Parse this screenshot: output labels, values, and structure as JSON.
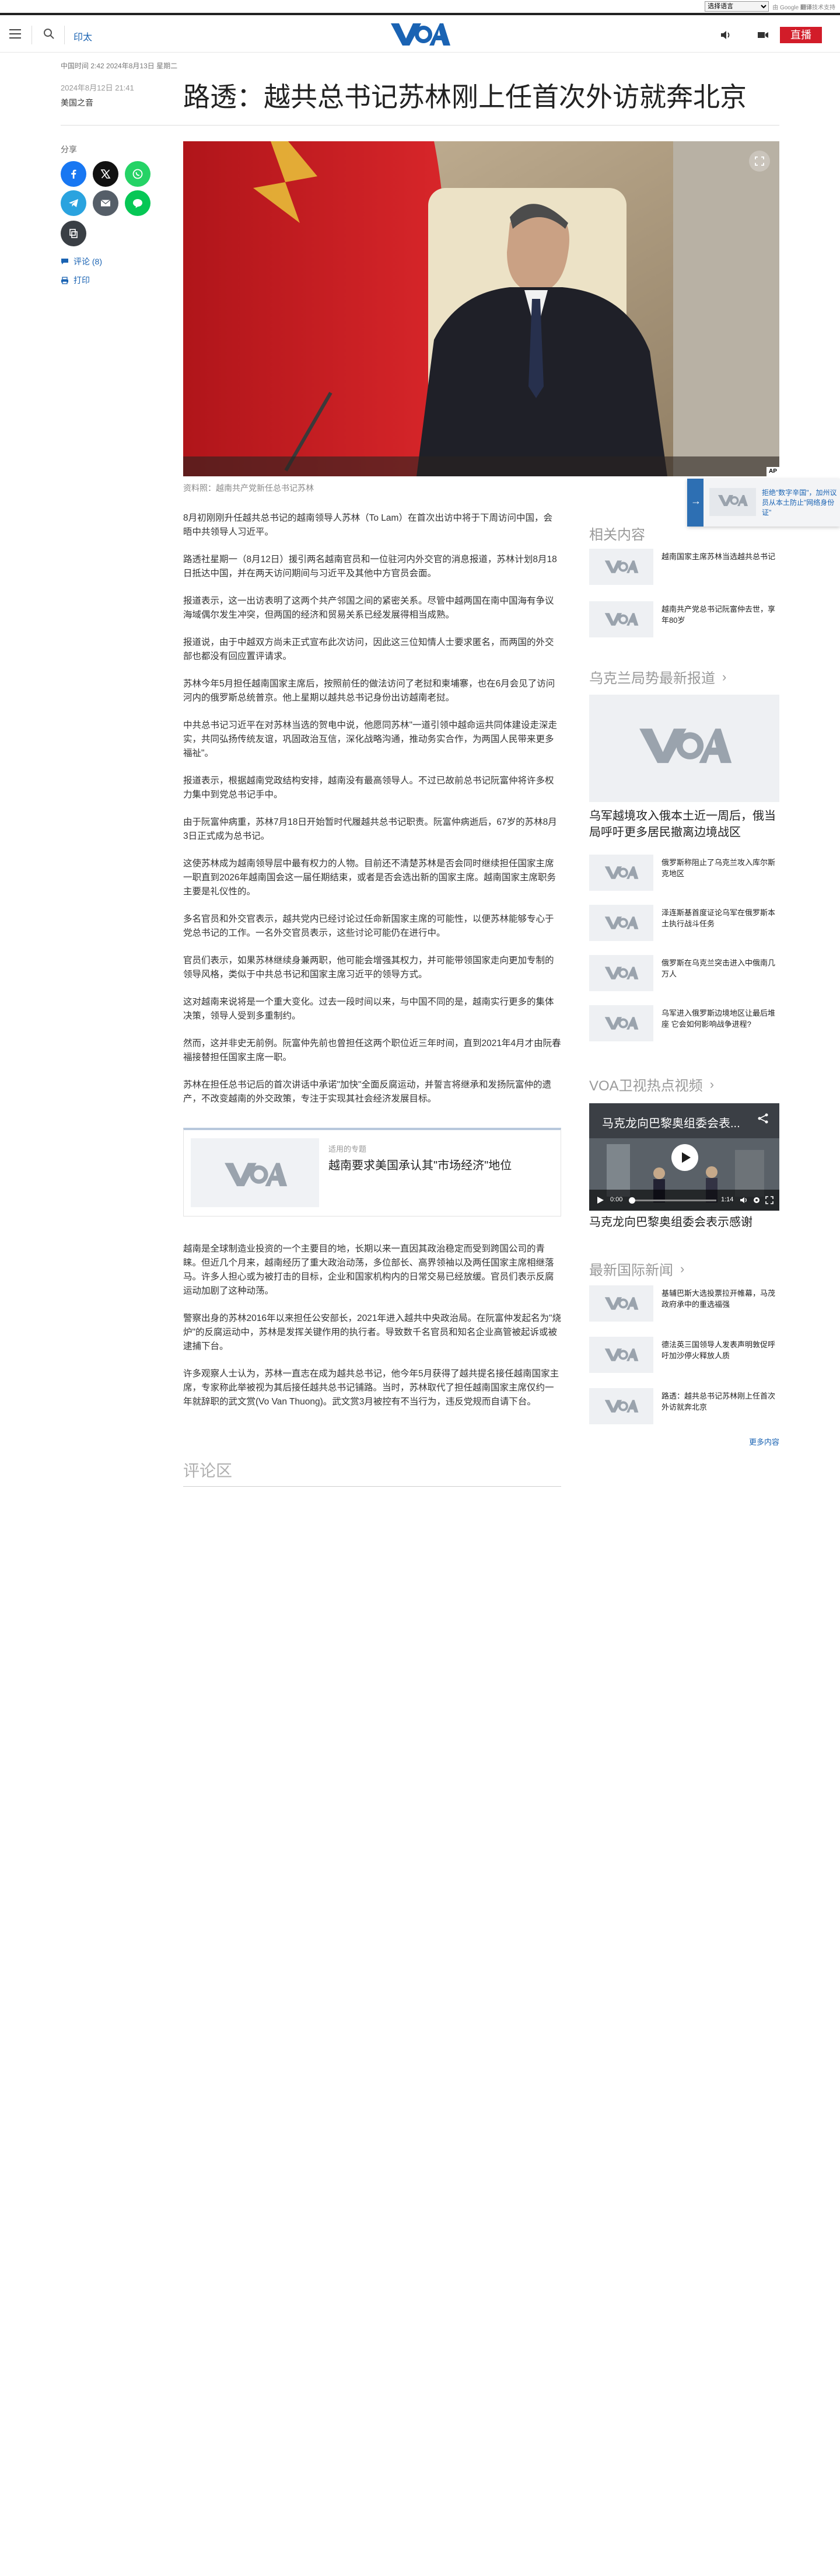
{
  "translate": {
    "select_label": "选择语言",
    "powered_by": "由",
    "powered_brand": "Google",
    "powered_suffix": "翻译",
    "powered_end": "技术支持"
  },
  "header": {
    "edition": "印太",
    "logo": "VOA",
    "live_label": "直播",
    "live_color": "#d21c29"
  },
  "meta": {
    "time_line": "中国时间 2:42 2024年8月13日 星期二",
    "published": "2024年8月12日 21:41",
    "author": "美国之音"
  },
  "article": {
    "title": "路透：越共总书记苏林刚上任首次外访就奔北京",
    "caption": "资料照：越南共产党新任总书记苏林",
    "paragraphs": [
      "8月初刚刚升任越共总书记的越南领导人苏林（To Lam）在首次出访中将于下周访问中国，会晤中共领导人习近平。",
      "路透社星期一（8月12日）援引两名越南官员和一位驻河内外交官的消息报道，苏林计划8月18日抵达中国，并在两天访问期间与习近平及其他中方官员会面。",
      "报道表示，这一出访表明了这两个共产邻国之间的紧密关系。尽管中越两国在南中国海有争议海域偶尔发生冲突，但两国的经济和贸易关系已经发展得相当成熟。",
      "报道说，由于中越双方尚未正式宣布此次访问，因此这三位知情人士要求匿名，而两国的外交部也都没有回应置评请求。",
      "苏林今年5月担任越南国家主席后，按照前任的做法访问了老挝和柬埔寨，也在6月会见了访问河内的俄罗斯总统普京。他上星期以越共总书记身份出访越南老挝。",
      "中共总书记习近平在对苏林当选的贺电中说，他愿同苏林\"一道引领中越命运共同体建设走深走实，共同弘扬传统友谊，巩固政治互信，深化战略沟通，推动务实合作，为两国人民带来更多福祉\"。",
      "报道表示，根据越南党政结构安排，越南没有最高领导人。不过已故前总书记阮富仲将许多权力集中到党总书记手中。",
      "由于阮富仲病重，苏林7月18日开始暂时代履越共总书记职责。阮富仲病逝后，67岁的苏林8月3日正式成为总书记。",
      "这使苏林成为越南领导层中最有权力的人物。目前还不清楚苏林是否会同时继续担任国家主席一职直到2026年越南国会这一届任期结束，或者是否会选出新的国家主席。越南国家主席职务主要是礼仪性的。",
      "多名官员和外交官表示，越共党内已经讨论过任命新国家主席的可能性，以便苏林能够专心于党总书记的工作。一名外交官员表示，这些讨论可能仍在进行中。",
      "官员们表示，如果苏林继续身兼两职，他可能会增强其权力，并可能带领国家走向更加专制的领导风格，类似于中共总书记和国家主席习近平的领导方式。",
      "这对越南来说将是一个重大变化。过去一段时间以来，与中国不同的是，越南实行更多的集体决策，领导人受到多重制约。",
      "然而，这并非史无前例。阮富仲先前也曾担任这两个职位近三年时间，直到2021年4月才由阮春福接替担任国家主席一职。",
      "苏林在担任总书记后的首次讲话中承诺\"加快\"全面反腐运动，并誓言将继承和发扬阮富仲的遗产，不改变越南的外交政策，专注于实现其社会经济发展目标。"
    ],
    "related_label": "适用的专题",
    "related_title": "越南要求美国承认其\"市场经济\"地位",
    "paragraphs2": [
      "越南是全球制造业投资的一个主要目的地，长期以来一直因其政治稳定而受到跨国公司的青睐。但近几个月来，越南经历了重大政治动荡，多位部长、高界领袖以及两任国家主席相继落马。许多人担心或为被打击的目标，企业和国家机构内的日常交易已经放缓。官员们表示反腐运动加剧了这种动荡。",
      "警察出身的苏林2016年以来担任公安部长，2021年进入越共中央政治局。在阮富仲发起名为\"烧炉\"的反腐运动中，苏林是发挥关键作用的执行者。导致数千名官员和知名企业高管被起诉或被逮捕下台。",
      "许多观察人士认为，苏林一直志在成为越共总书记，他今年5月获得了越共提名接任越南国家主席，专家称此举被视为其后接任越共总书记铺路。当时，苏林取代了担任越南国家主席仅约一年就辞职的武文赏(Vo Van Thuong)。武文赏3月被控有不当行为，违反党规而自请下台。"
    ],
    "comments_title": "评论区"
  },
  "share": {
    "label": "分享",
    "comments_link": "评论 (8)",
    "print_link": "打印",
    "colors": {
      "facebook": "#1877f2",
      "x": "#111111",
      "whatsapp": "#25d366",
      "telegram": "#2aa3df",
      "email": "#555e68",
      "line": "#06c755",
      "copy": "#3a3f45"
    }
  },
  "sidebar": {
    "related_title": "相关内容",
    "related_items": [
      "越南国家主席苏林当选越共总书记",
      "越南共产党总书记阮富仲去世，享年80岁"
    ],
    "ukraine_title": "乌克兰局势最新报道",
    "ukraine_big_caption": "乌军越境攻入俄本土近一周后，俄当局呼吁更多居民撤离边境战区",
    "ukraine_items": [
      "俄罗斯称阻止了乌克兰攻入库尔斯克地区",
      "泽连斯基首度证论乌军在俄罗斯本土执行战斗任务",
      "俄罗斯在乌克兰突击进入中俄南几万人",
      "乌军进入俄罗斯边境地区让最后堆座 它会如何影响战争进程?"
    ],
    "video_section_title": "VOA卫视热点视频",
    "video_title": "马克龙向巴黎奥组委会表...",
    "video_time_current": "0:00",
    "video_time_total": "1:14",
    "video_caption": "马克龙向巴黎奥组委会表示感谢",
    "news_title": "最新国际新闻",
    "news_items": [
      "基辅巴斯大选投票拉开帷幕，马茂政府承中的重选福强",
      "德法英三国领导人发表声明敦促呼吁加沙停火释放人质",
      "路透：越共总书记苏林刚上任首次外访就奔北京"
    ],
    "more_link": "更多内容"
  },
  "popup": {
    "text": "拒绝\"数字辛国\"，加州议员从本土防止\"网络身份证\""
  }
}
